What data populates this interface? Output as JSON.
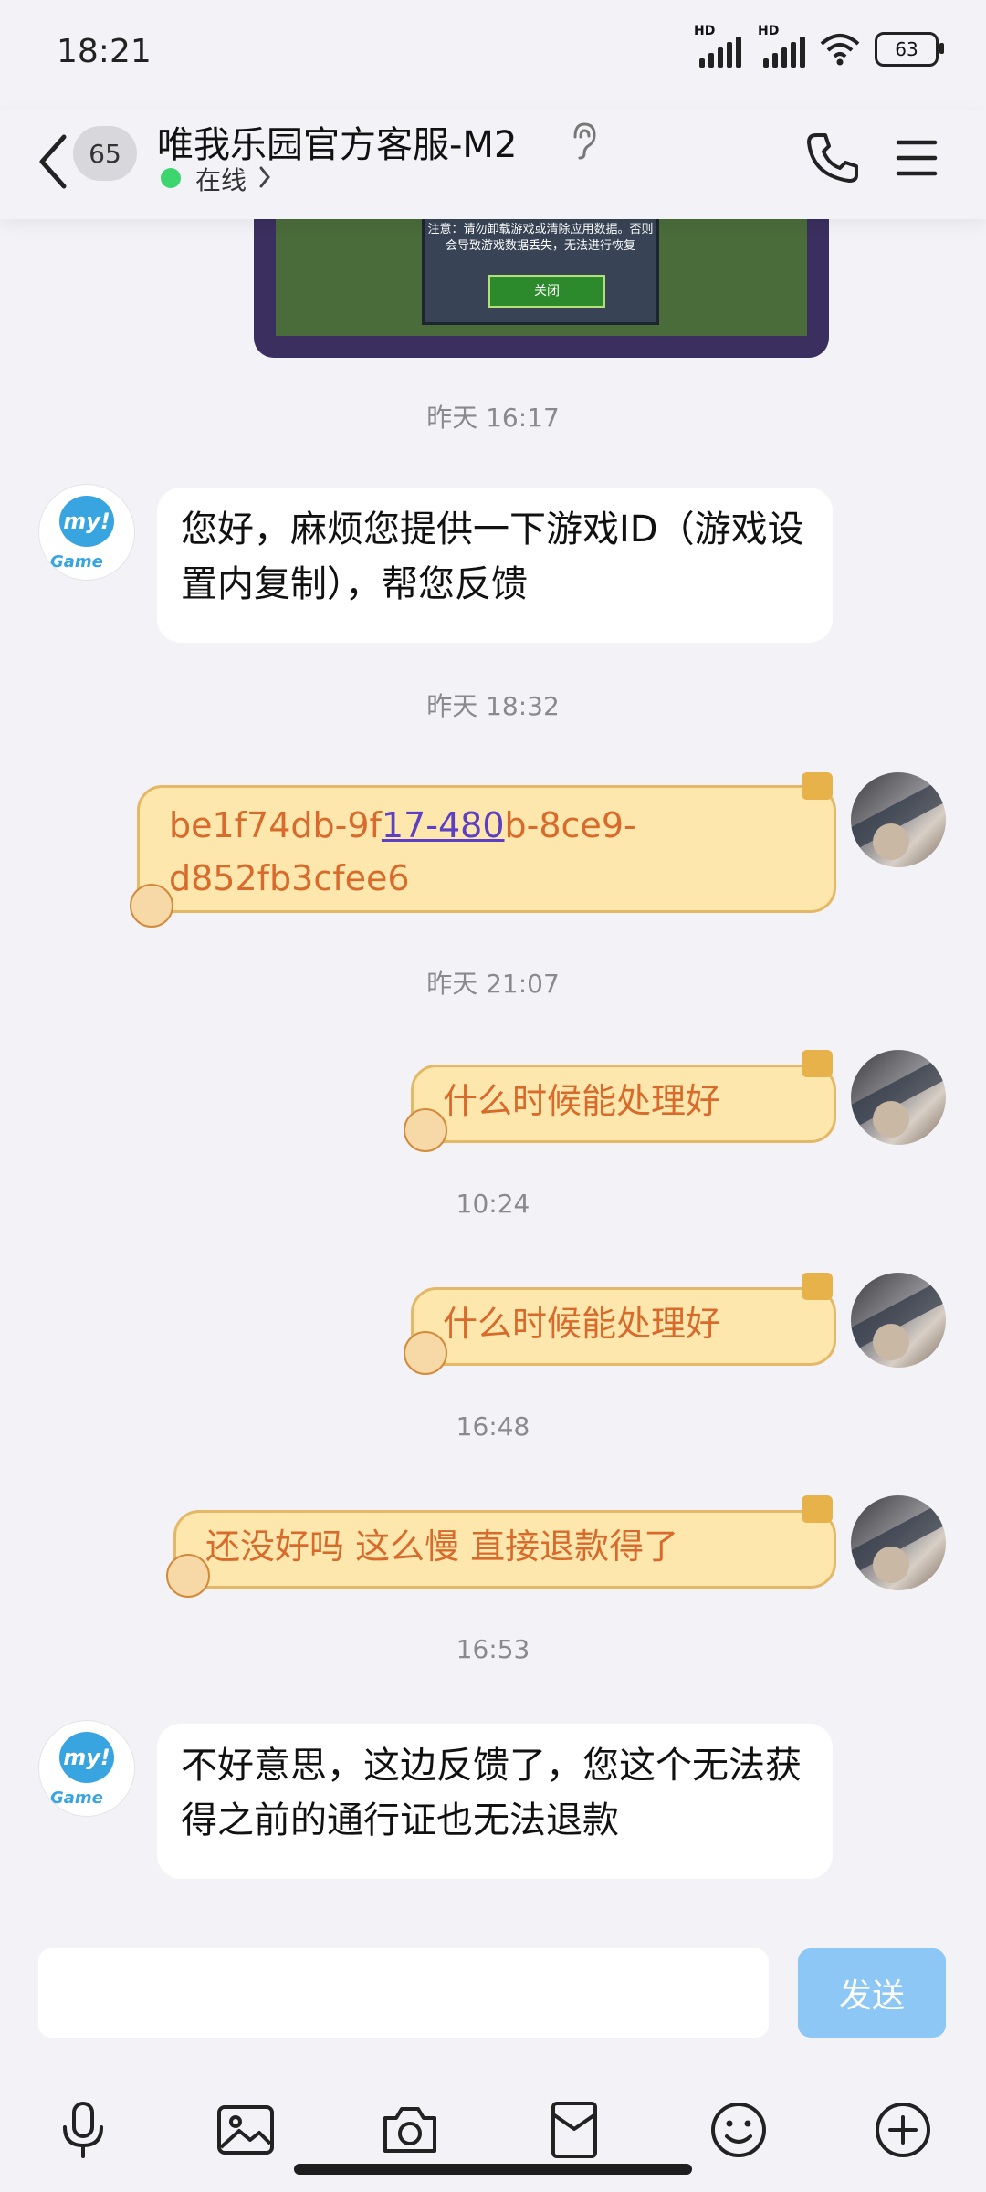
{
  "status_bar": {
    "time": "18:21",
    "battery": "63",
    "hd1": "HD",
    "hd2": "HD"
  },
  "header": {
    "unread_count": "65",
    "title": "唯我乐园官方客服-M2",
    "status": "在线"
  },
  "top_image": {
    "dialog_text": "注意：请勿卸载游戏或清除应用数据。否则会导致游戏数据丢失，无法进行恢复",
    "button": "关闭"
  },
  "avatars": {
    "bot_logo": "my!",
    "bot_word": "Game"
  },
  "messages": [
    {
      "type": "timestamp",
      "text": "昨天 16:17"
    },
    {
      "type": "incoming",
      "text": "您好，麻烦您提供一下游戏ID（游戏设置内复制），帮您反馈"
    },
    {
      "type": "timestamp",
      "text": "昨天 18:32"
    },
    {
      "type": "outgoing",
      "text_before": "be1f74db-9f",
      "text_link": "17-480",
      "text_after": "b-8ce9-d852fb3cfee6"
    },
    {
      "type": "timestamp",
      "text": "昨天 21:07"
    },
    {
      "type": "outgoing",
      "text": "什么时候能处理好"
    },
    {
      "type": "timestamp",
      "text": "10:24"
    },
    {
      "type": "outgoing",
      "text": "什么时候能处理好"
    },
    {
      "type": "timestamp",
      "text": "16:48"
    },
    {
      "type": "outgoing",
      "text": "还没好吗 这么慢 直接退款得了"
    },
    {
      "type": "timestamp",
      "text": "16:53"
    },
    {
      "type": "incoming",
      "text": "不好意思，这边反馈了，您这个无法获得之前的通行证也无法退款"
    }
  ],
  "input": {
    "send_label": "发送"
  },
  "toolbar": [
    "microphone-icon",
    "image-icon",
    "camera-icon",
    "red-packet-icon",
    "emoji-icon",
    "plus-icon"
  ],
  "colors": {
    "accent": "#8cc7f5",
    "bubble_out": "#fde7ad",
    "text_out": "#d86b2c",
    "online": "#3dd56d"
  }
}
